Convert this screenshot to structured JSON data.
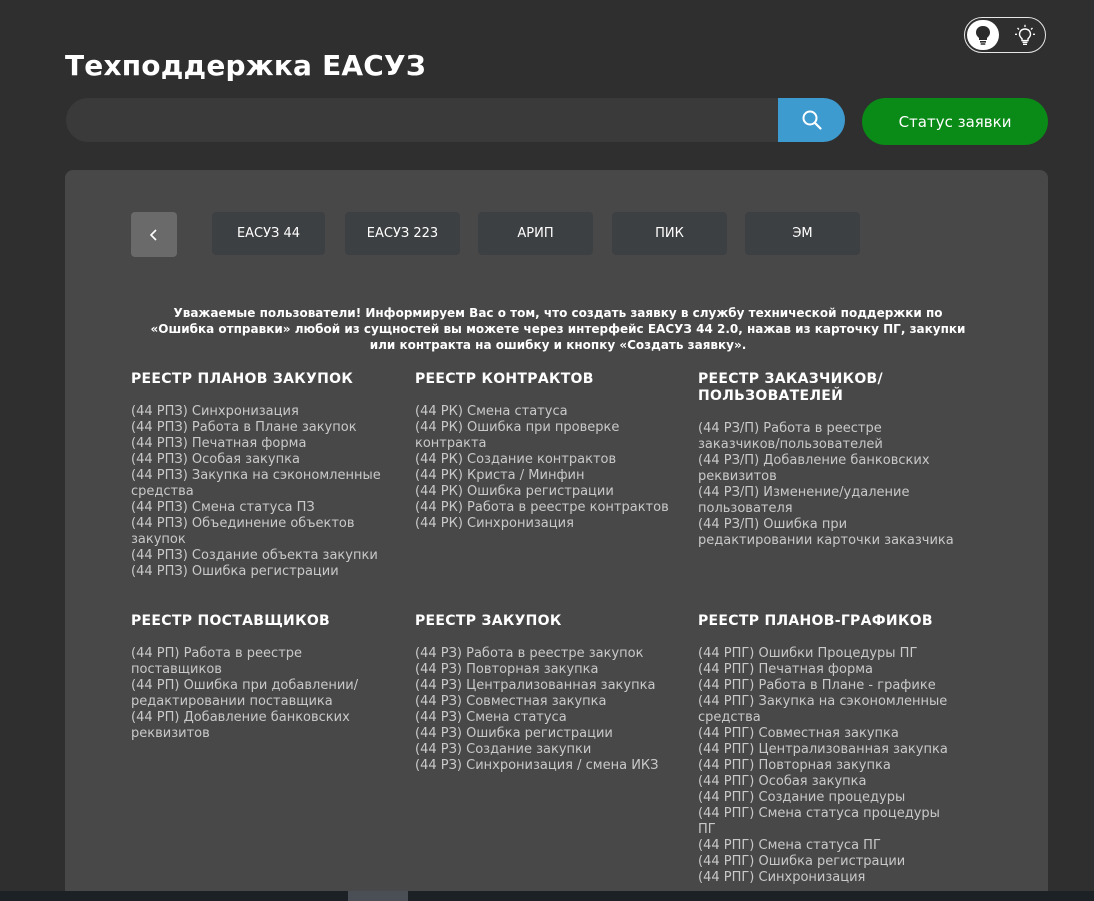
{
  "header": {
    "title": "Техподдержка ЕАСУЗ",
    "status_button": "Статус заявки"
  },
  "search": {
    "placeholder": "",
    "value": ""
  },
  "theme_toggle": {
    "active": "dark-bulb-icon",
    "inactive": "light-bulb-icon"
  },
  "tabs": [
    {
      "label": "ЕАСУЗ 44"
    },
    {
      "label": "ЕАСУЗ 223"
    },
    {
      "label": "АРИП"
    },
    {
      "label": "ПИК"
    },
    {
      "label": "ЭМ"
    }
  ],
  "notice": "Уважаемые пользователи! Информируем Вас о том, что создать заявку в службу технической поддержки по «Ошибка отправки» любой из сущностей вы можете через интерфейс ЕАСУЗ 44 2.0, нажав из карточку ПГ, закупки или контракта на ошибку и кнопку «Создать заявку».",
  "sections": [
    {
      "title": "РЕЕСТР ПЛАНОВ ЗАКУПОК",
      "items": [
        "(44 РПЗ) Синхронизация",
        "(44 РПЗ) Работа в Плане закупок",
        "(44 РПЗ) Печатная форма",
        "(44 РПЗ) Особая закупка",
        "(44 РПЗ) Закупка на сэкономленные средства",
        "(44 РПЗ) Смена статуса ПЗ",
        "(44 РПЗ) Объединение объектов закупок",
        "(44 РПЗ) Создание объекта закупки",
        "(44 РПЗ) Ошибка регистрации"
      ]
    },
    {
      "title": "РЕЕСТР КОНТРАКТОВ",
      "items": [
        "(44 РК) Смена статуса",
        "(44 РК) Ошибка при проверке контракта",
        "(44 РК) Создание контрактов",
        "(44 РК) Криста / Минфин",
        "(44 РК) Ошибка регистрации",
        "(44 РК) Работа в реестре контрактов",
        "(44 РК) Синхронизация"
      ]
    },
    {
      "title": "РЕЕСТР ЗАКАЗЧИКОВ/ ПОЛЬЗОВАТЕЛЕЙ",
      "items": [
        "(44 РЗ/П) Работа в реестре заказчиков/пользователей",
        "(44 РЗ/П) Добавление банковских реквизитов",
        "(44 РЗ/П) Изменение/удаление пользователя",
        "(44 РЗ/П) Ошибка при редактировании карточки заказчика"
      ]
    },
    {
      "title": "РЕЕСТР ПОСТАВЩИКОВ",
      "items": [
        "(44 РП) Работа в реестре поставщиков",
        "(44 РП) Ошибка при добавлении/ редактировании поставщика",
        "(44 РП) Добавление банковских реквизитов"
      ]
    },
    {
      "title": "РЕЕСТР ЗАКУПОК",
      "items": [
        "(44 РЗ) Работа в реестре закупок",
        "(44 РЗ) Повторная закупка",
        "(44 РЗ) Централизованная закупка",
        "(44 РЗ) Совместная закупка",
        "(44 РЗ) Смена статуса",
        "(44 РЗ) Ошибка регистрации",
        "(44 РЗ) Создание закупки",
        "(44 РЗ) Синхронизация / смена ИКЗ"
      ]
    },
    {
      "title": "РЕЕСТР ПЛАНОВ-ГРАФИКОВ",
      "items": [
        "(44 РПГ) Ошибки Процедуры ПГ",
        "(44 РПГ) Печатная форма",
        "(44 РПГ) Работа в Плане - графике",
        "(44 РПГ) Закупка на сэкономленные средства",
        "(44 РПГ) Совместная закупка",
        "(44 РПГ) Централизованная закупка",
        "(44 РПГ) Повторная закупка",
        "(44 РПГ) Особая закупка",
        "(44 РПГ) Создание процедуры",
        "(44 РПГ) Смена статуса процедуры ПГ",
        "(44 РПГ) Смена статуса ПГ",
        "(44 РПГ) Ошибка регистрации",
        "(44 РПГ) Синхронизация"
      ]
    }
  ],
  "colors": {
    "background": "#2f2f2f",
    "panel": "#484848",
    "search_button": "#3e9bd0",
    "status_button": "#0a8a16",
    "tab": "#3d4042"
  }
}
